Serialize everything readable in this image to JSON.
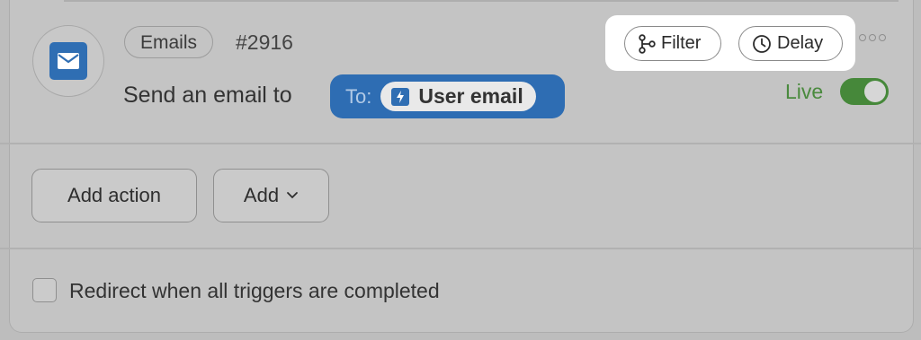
{
  "step": {
    "tag": "Emails",
    "number": "#2916",
    "description": "Send an email to",
    "to_label": "To:",
    "recipient": "User email",
    "icon": "mail-icon",
    "recipient_icon": "bolt-icon"
  },
  "toolbar": {
    "filter_label": "Filter",
    "delay_label": "Delay",
    "filter_icon": "branch-icon",
    "delay_icon": "clock-icon",
    "more_icon": "more-icon"
  },
  "status": {
    "label": "Live",
    "enabled": true
  },
  "actions": {
    "add_action_label": "Add action",
    "add_label": "Add"
  },
  "redirect": {
    "label": "Redirect when all triggers are completed",
    "checked": false
  },
  "colors": {
    "accent_blue": "#2f6eb3",
    "live_green": "#46883a"
  }
}
